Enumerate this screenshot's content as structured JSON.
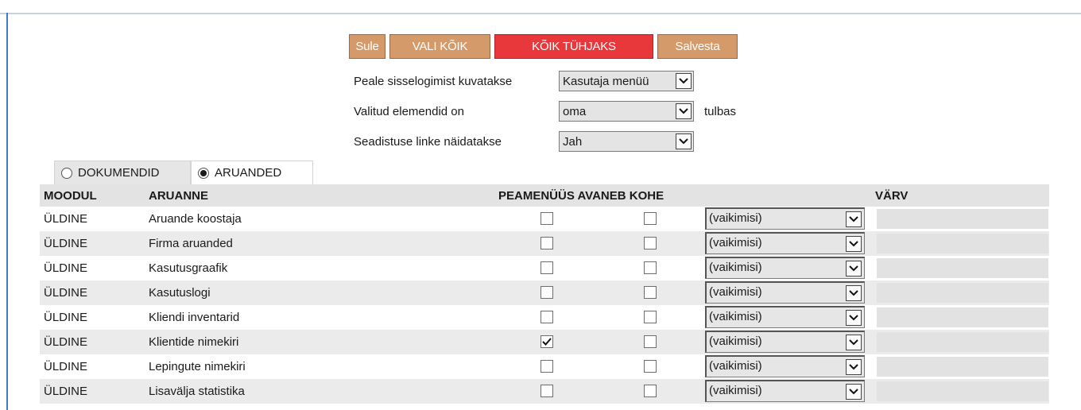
{
  "toolbar": {
    "sule": "Sule",
    "vali_koik": "VALI KÕIK",
    "koik_tuhjaks": "KÕIK TÜHJAKS",
    "salvesta": "Salvesta"
  },
  "settings": {
    "login_label": "Peale sisselogimist kuvatakse",
    "login_value": "Kasutaja menüü",
    "selected_label": "Valitud elemendid on",
    "selected_value": "oma",
    "selected_suffix": "tulbas",
    "links_label": "Seadistuse linke näidatakse",
    "links_value": "Jah"
  },
  "tabs": {
    "dokumendid": "DOKUMENDID",
    "aruanded": "ARUANDED",
    "active": "aruanded"
  },
  "table": {
    "headers": {
      "moodul": "MOODUL",
      "aruanne": "ARUANNE",
      "peamenuus_avaneb_kohe": "PEAMENÜÜS AVANEB KOHE",
      "varv": "VÄRV"
    },
    "rows": [
      {
        "moodul": "ÜLDINE",
        "aruanne": "Aruande koostaja",
        "peamenuus": false,
        "avaneb": false,
        "varv": "(vaikimisi)"
      },
      {
        "moodul": "ÜLDINE",
        "aruanne": "Firma aruanded",
        "peamenuus": false,
        "avaneb": false,
        "varv": "(vaikimisi)"
      },
      {
        "moodul": "ÜLDINE",
        "aruanne": "Kasutusgraafik",
        "peamenuus": false,
        "avaneb": false,
        "varv": "(vaikimisi)"
      },
      {
        "moodul": "ÜLDINE",
        "aruanne": "Kasutuslogi",
        "peamenuus": false,
        "avaneb": false,
        "varv": "(vaikimisi)"
      },
      {
        "moodul": "ÜLDINE",
        "aruanne": "Kliendi inventarid",
        "peamenuus": false,
        "avaneb": false,
        "varv": "(vaikimisi)"
      },
      {
        "moodul": "ÜLDINE",
        "aruanne": "Klientide nimekiri",
        "peamenuus": true,
        "avaneb": false,
        "varv": "(vaikimisi)"
      },
      {
        "moodul": "ÜLDINE",
        "aruanne": "Lepingute nimekiri",
        "peamenuus": false,
        "avaneb": false,
        "varv": "(vaikimisi)"
      },
      {
        "moodul": "ÜLDINE",
        "aruanne": "Lisavälja statistika",
        "peamenuus": false,
        "avaneb": false,
        "varv": "(vaikimisi)"
      }
    ]
  },
  "colors": {
    "button": "#d49a6a",
    "button_danger": "#e8383b",
    "row_alt": "#ebebeb",
    "header_bg": "#e3e3e3"
  }
}
